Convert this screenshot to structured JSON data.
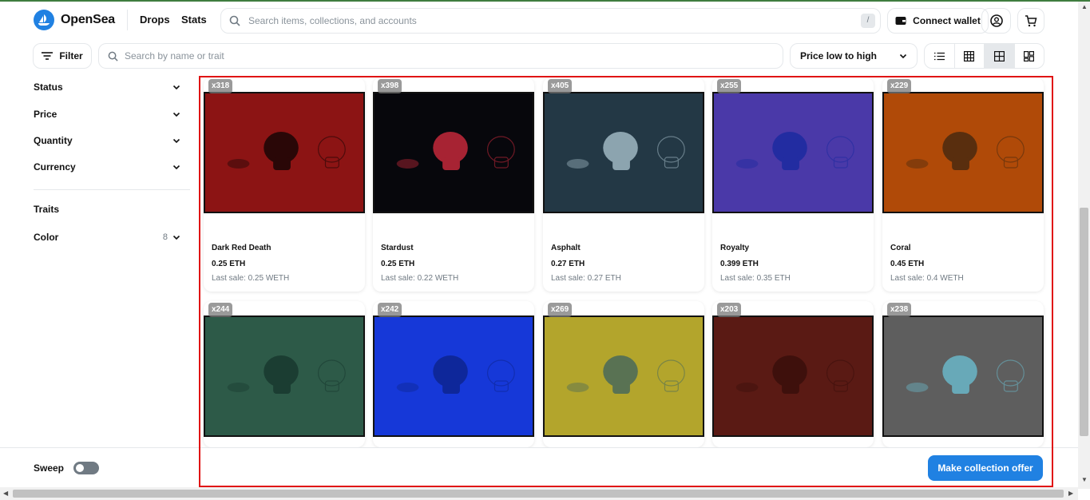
{
  "header": {
    "brand": "OpenSea",
    "nav": [
      "Drops",
      "Stats"
    ],
    "search_placeholder": "Search items, collections, and accounts",
    "search_shortcut": "/",
    "connect_wallet": "Connect wallet"
  },
  "toolbar": {
    "filter_label": "Filter",
    "trait_search_placeholder": "Search by name or trait",
    "sort_label": "Price low to high"
  },
  "sidebar": {
    "status": "Status",
    "price": "Price",
    "quantity": "Quantity",
    "currency": "Currency",
    "traits": "Traits",
    "color": "Color",
    "color_count": "8"
  },
  "footer": {
    "sweep": "Sweep",
    "offer_button": "Make collection offer"
  },
  "items": [
    {
      "badge": "x318",
      "name": "Dark Red Death",
      "price": "0.25 ETH",
      "last_sale": "Last sale: 0.25 WETH",
      "bg": "#8c1414",
      "fg": "#1a0505"
    },
    {
      "badge": "x398",
      "name": "Stardust",
      "price": "0.25 ETH",
      "last_sale": "Last sale: 0.22 WETH",
      "bg": "#07070c",
      "fg": "#c4283a"
    },
    {
      "badge": "x405",
      "name": "Asphalt",
      "price": "0.27 ETH",
      "last_sale": "Last sale: 0.27 ETH",
      "bg": "#233845",
      "fg": "#9fb7c2"
    },
    {
      "badge": "x255",
      "name": "Royalty",
      "price": "0.399 ETH",
      "last_sale": "Last sale: 0.35 ETH",
      "bg": "#4a39a8",
      "fg": "#1c2aa0"
    },
    {
      "badge": "x229",
      "name": "Coral",
      "price": "0.45 ETH",
      "last_sale": "Last sale: 0.4 WETH",
      "bg": "#b04a08",
      "fg": "#4a2a10"
    },
    {
      "badge": "x244",
      "bg": "#2d5a48",
      "fg": "#18392f"
    },
    {
      "badge": "x242",
      "bg": "#1638d8",
      "fg": "#0d2590"
    },
    {
      "badge": "x269",
      "bg": "#b3a52c",
      "fg": "#4a6a5a"
    },
    {
      "badge": "x203",
      "bg": "#5a1a14",
      "fg": "#3a0f0b"
    },
    {
      "badge": "x238",
      "bg": "#5e5e5e",
      "fg": "#6ab7c8"
    }
  ]
}
